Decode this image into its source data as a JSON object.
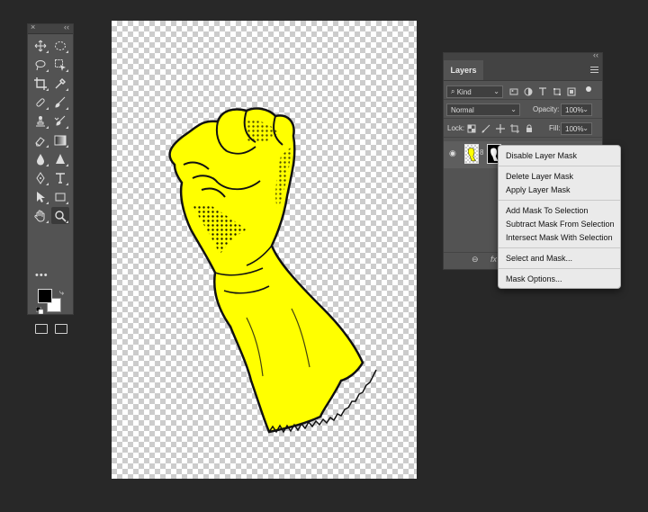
{
  "tools_panel": {
    "close_glyph": "×",
    "collapse_glyph": "‹‹",
    "more_tools_glyph": "•••",
    "tools": [
      {
        "name": "move-tool-icon"
      },
      {
        "name": "elliptical-marquee-icon"
      },
      {
        "name": "lasso-icon"
      },
      {
        "name": "object-selection-icon"
      },
      {
        "name": "crop-icon"
      },
      {
        "name": "eyedropper-icon"
      },
      {
        "name": "spot-healing-icon"
      },
      {
        "name": "brush-icon"
      },
      {
        "name": "clone-stamp-icon"
      },
      {
        "name": "history-brush-icon"
      },
      {
        "name": "eraser-icon"
      },
      {
        "name": "gradient-icon"
      },
      {
        "name": "blur-icon"
      },
      {
        "name": "dodge-icon"
      },
      {
        "name": "pen-icon"
      },
      {
        "name": "type-icon"
      },
      {
        "name": "path-selection-icon"
      },
      {
        "name": "rectangle-icon"
      },
      {
        "name": "hand-icon"
      },
      {
        "name": "zoom-icon"
      }
    ],
    "foreground_color": "#000000",
    "background_color": "#ffffff"
  },
  "layers_panel": {
    "collapse_glyph": "‹‹",
    "tab_label": "Layers",
    "filter": {
      "value": "Kind",
      "search_glyph": "⌕"
    },
    "blend_mode": "Normal",
    "opacity": {
      "label": "Opacity:",
      "value": "100%"
    },
    "lock_label": "Lock:",
    "fill": {
      "label": "Fill:",
      "value": "100%"
    },
    "layer": {
      "visibility_glyph": "◉",
      "link_glyph": "8"
    },
    "bottom_icons": [
      "link-layers-icon",
      "fx-icon"
    ],
    "bottom_fx_label": "fx"
  },
  "context_menu": {
    "groups": [
      [
        "Disable Layer Mask"
      ],
      [
        "Delete Layer Mask",
        "Apply Layer Mask"
      ],
      [
        "Add Mask To Selection",
        "Subtract Mask From Selection",
        "Intersect Mask With Selection"
      ],
      [
        "Select and Mask..."
      ],
      [
        "Mask Options..."
      ]
    ]
  },
  "canvas": {
    "subject_color": "#ffff00"
  }
}
